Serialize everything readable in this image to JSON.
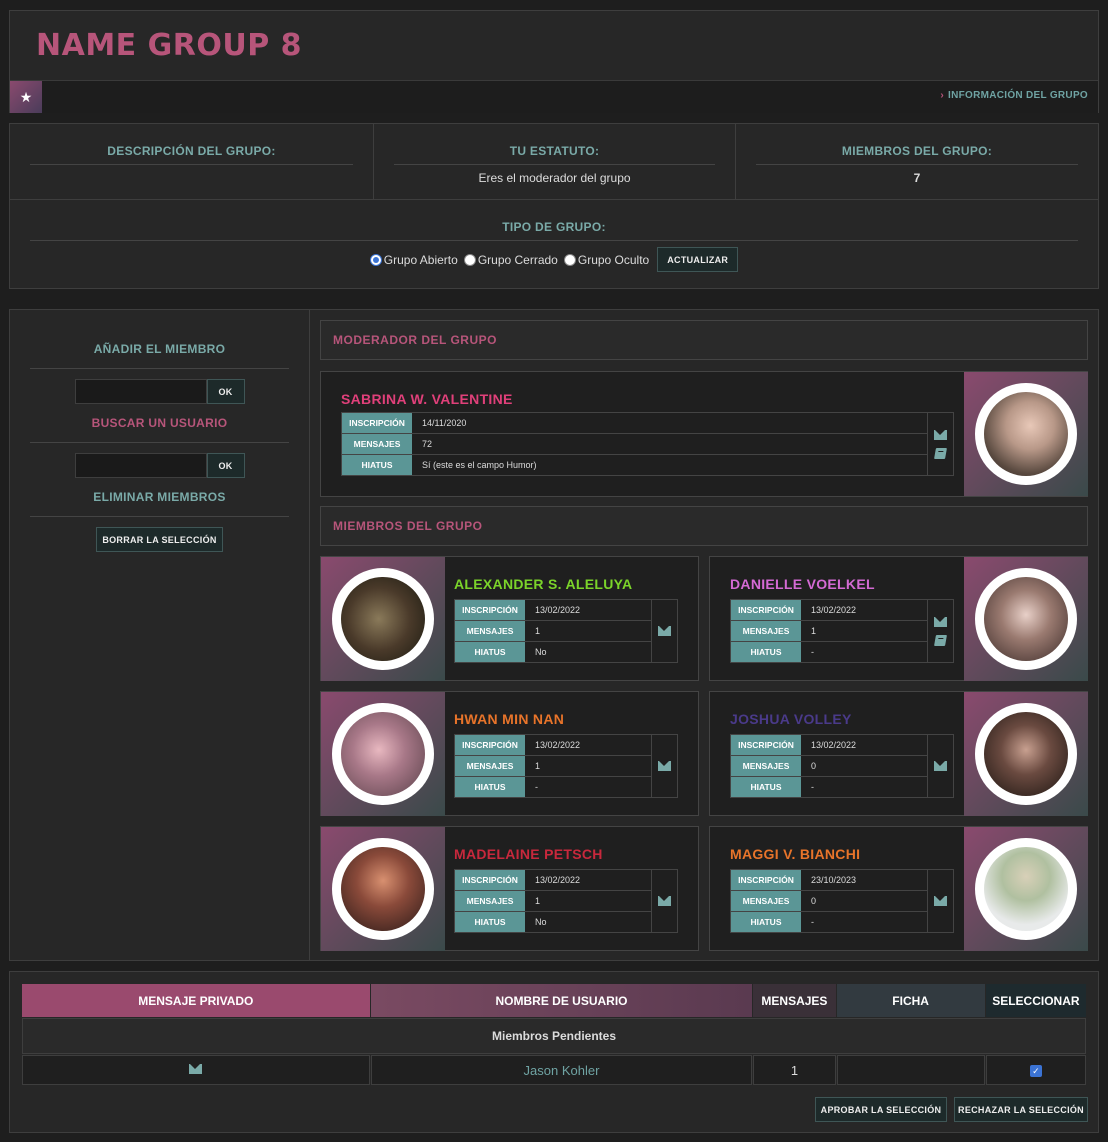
{
  "header": {
    "title": "NAME GROUP 8",
    "info_link": "INFORMACIÓN DEL GRUPO"
  },
  "stats": {
    "desc_label": "DESCRIPCIÓN DEL GRUPO:",
    "status_label": "TU ESTATUTO:",
    "status_value": "Eres el moderador del grupo",
    "members_label": "MIEMBROS DEL GRUPO:",
    "members_value": "7",
    "type_label": "TIPO DE GRUPO:",
    "type_options": [
      "Grupo Abierto",
      "Grupo Cerrado",
      "Grupo Oculto"
    ],
    "type_selected": "Grupo Abierto",
    "update_button": "ACTUALIZAR"
  },
  "sidebar": {
    "add_label": "AÑADIR EL MIEMBRO",
    "search_label": "BUSCAR UN USUARIO",
    "remove_label": "ELIMINAR MIEMBROS",
    "ok_label": "OK",
    "delete_button": "BORRAR LA SELECCIÓN"
  },
  "labels": {
    "inscripcion": "INSCRIPCIÓN",
    "mensajes": "MENSAJES",
    "hiatus": "HIATUS"
  },
  "moderator_section": {
    "title": "MODERADOR DEL GRUPO",
    "name": "SABRINA W. VALENTINE",
    "name_color": "#e0407a",
    "inscripcion": "14/11/2020",
    "mensajes": "72",
    "hiatus": "Sí (este es el campo Humor)"
  },
  "members_section": {
    "title": "MIEMBROS DEL GRUPO",
    "members": [
      {
        "name": "ALEXANDER S. ALELUYA",
        "color": "#7bd42a",
        "inscripcion": "13/02/2022",
        "mensajes": "1",
        "hiatus": "No"
      },
      {
        "name": "DANIELLE VOELKEL",
        "color": "#d46ad4",
        "inscripcion": "13/02/2022",
        "mensajes": "1",
        "hiatus": "-"
      },
      {
        "name": "HWAN MIN NAN",
        "color": "#e8742a",
        "inscripcion": "13/02/2022",
        "mensajes": "1",
        "hiatus": "-"
      },
      {
        "name": "JOSHUA VOLLEY",
        "color": "#4a3a8a",
        "inscripcion": "13/02/2022",
        "mensajes": "0",
        "hiatus": "-"
      },
      {
        "name": "MADELAINE PETSCH",
        "color": "#c8283c",
        "inscripcion": "13/02/2022",
        "mensajes": "1",
        "hiatus": "No"
      },
      {
        "name": "MAGGI V. BIANCHI",
        "color": "#e8742a",
        "inscripcion": "23/10/2023",
        "mensajes": "0",
        "hiatus": "-"
      }
    ]
  },
  "pending": {
    "headers": [
      "MENSAJE PRIVADO",
      "NOMBRE DE USUARIO",
      "MENSAJES",
      "FICHA",
      "SELECCIONAR"
    ],
    "group_label": "Miembros Pendientes",
    "rows": [
      {
        "username": "Jason Kohler",
        "mensajes": "1"
      }
    ],
    "approve_button": "APROBAR LA SELECCIÓN",
    "reject_button": "RECHAZAR LA SELECCIÓN"
  }
}
